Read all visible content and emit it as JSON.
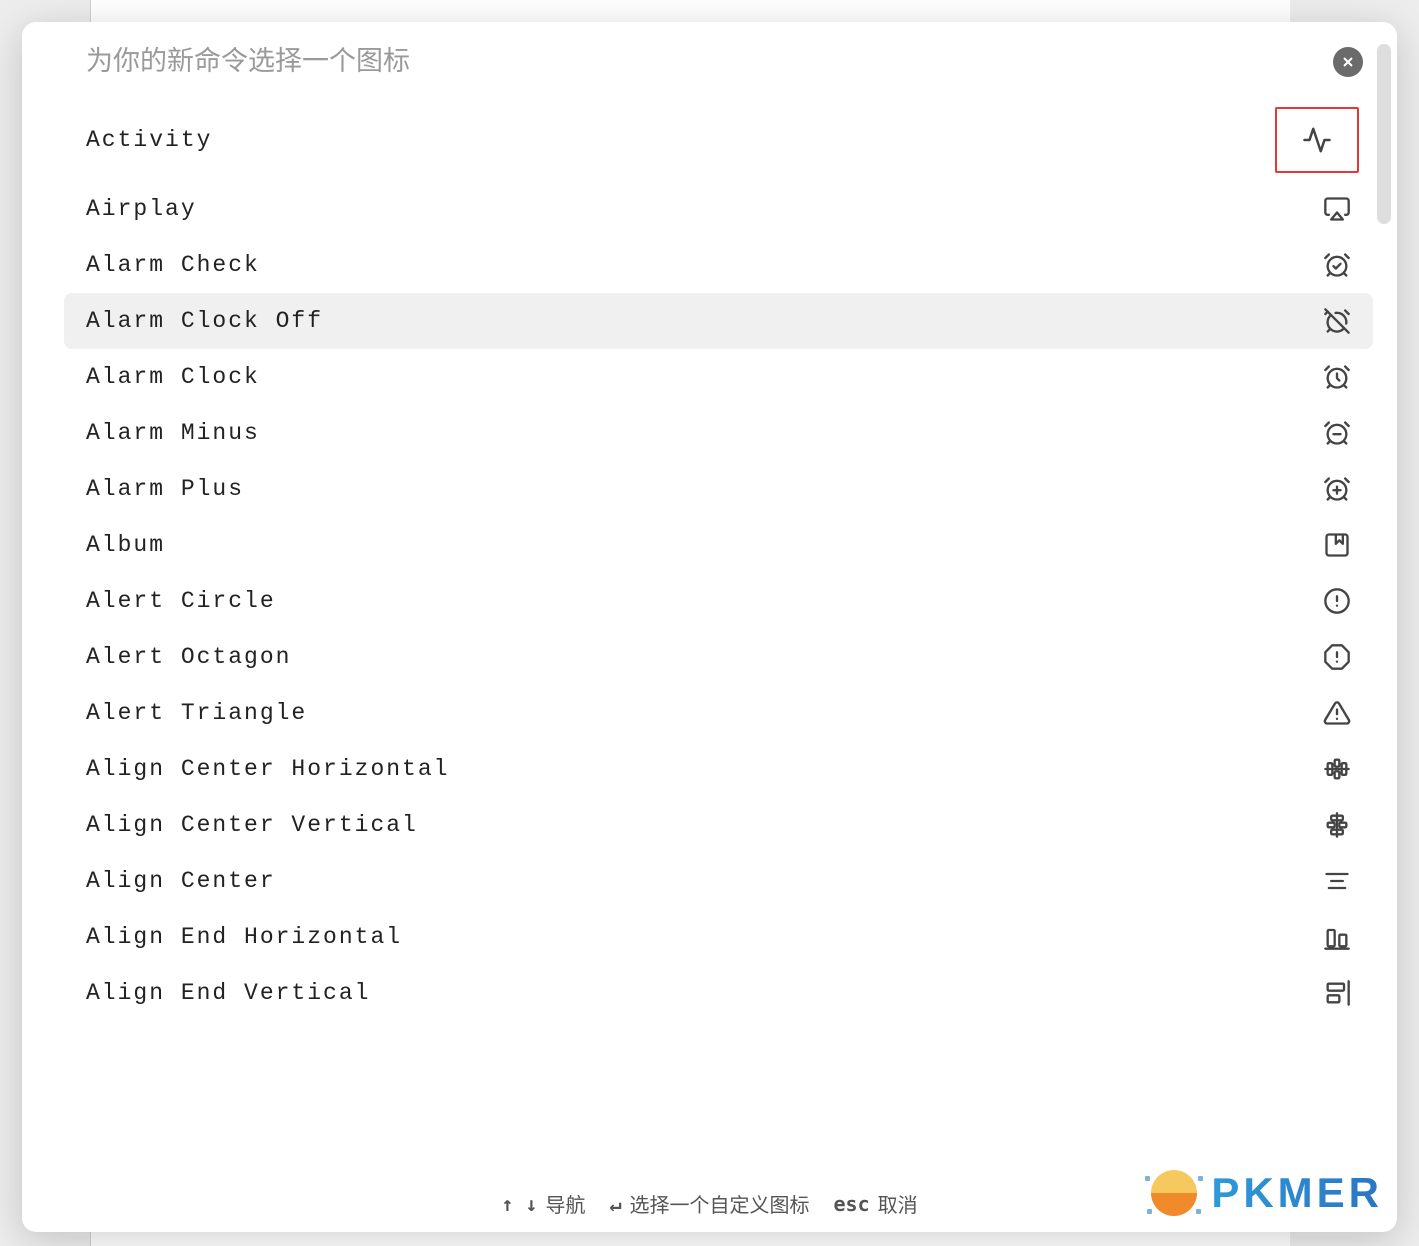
{
  "search": {
    "placeholder": "为你的新命令选择一个图标",
    "value": ""
  },
  "close_label": "close",
  "items": [
    {
      "label": "Activity",
      "icon": "activity",
      "highlighted": false,
      "boxed": true
    },
    {
      "label": "Airplay",
      "icon": "airplay",
      "highlighted": false
    },
    {
      "label": "Alarm Check",
      "icon": "alarm-check",
      "highlighted": false
    },
    {
      "label": "Alarm Clock Off",
      "icon": "alarm-clock-off",
      "highlighted": true
    },
    {
      "label": "Alarm Clock",
      "icon": "alarm-clock",
      "highlighted": false
    },
    {
      "label": "Alarm Minus",
      "icon": "alarm-minus",
      "highlighted": false
    },
    {
      "label": "Alarm Plus",
      "icon": "alarm-plus",
      "highlighted": false
    },
    {
      "label": "Album",
      "icon": "album",
      "highlighted": false
    },
    {
      "label": "Alert Circle",
      "icon": "alert-circle",
      "highlighted": false
    },
    {
      "label": "Alert Octagon",
      "icon": "alert-octagon",
      "highlighted": false
    },
    {
      "label": "Alert Triangle",
      "icon": "alert-triangle",
      "highlighted": false
    },
    {
      "label": "Align Center Horizontal",
      "icon": "align-center-horizontal",
      "highlighted": false
    },
    {
      "label": "Align Center Vertical",
      "icon": "align-center-vertical",
      "highlighted": false
    },
    {
      "label": "Align Center",
      "icon": "align-center",
      "highlighted": false
    },
    {
      "label": "Align End Horizontal",
      "icon": "align-end-horizontal",
      "highlighted": false
    },
    {
      "label": "Align End Vertical",
      "icon": "align-end-vertical",
      "highlighted": false
    }
  ],
  "footer": {
    "nav_keys": "↑ ↓",
    "nav_label": "导航",
    "enter_key": "↵",
    "enter_label": "选择一个自定义图标",
    "esc_key": "esc",
    "esc_label": "取消"
  },
  "watermark": {
    "text": "PKMER"
  }
}
